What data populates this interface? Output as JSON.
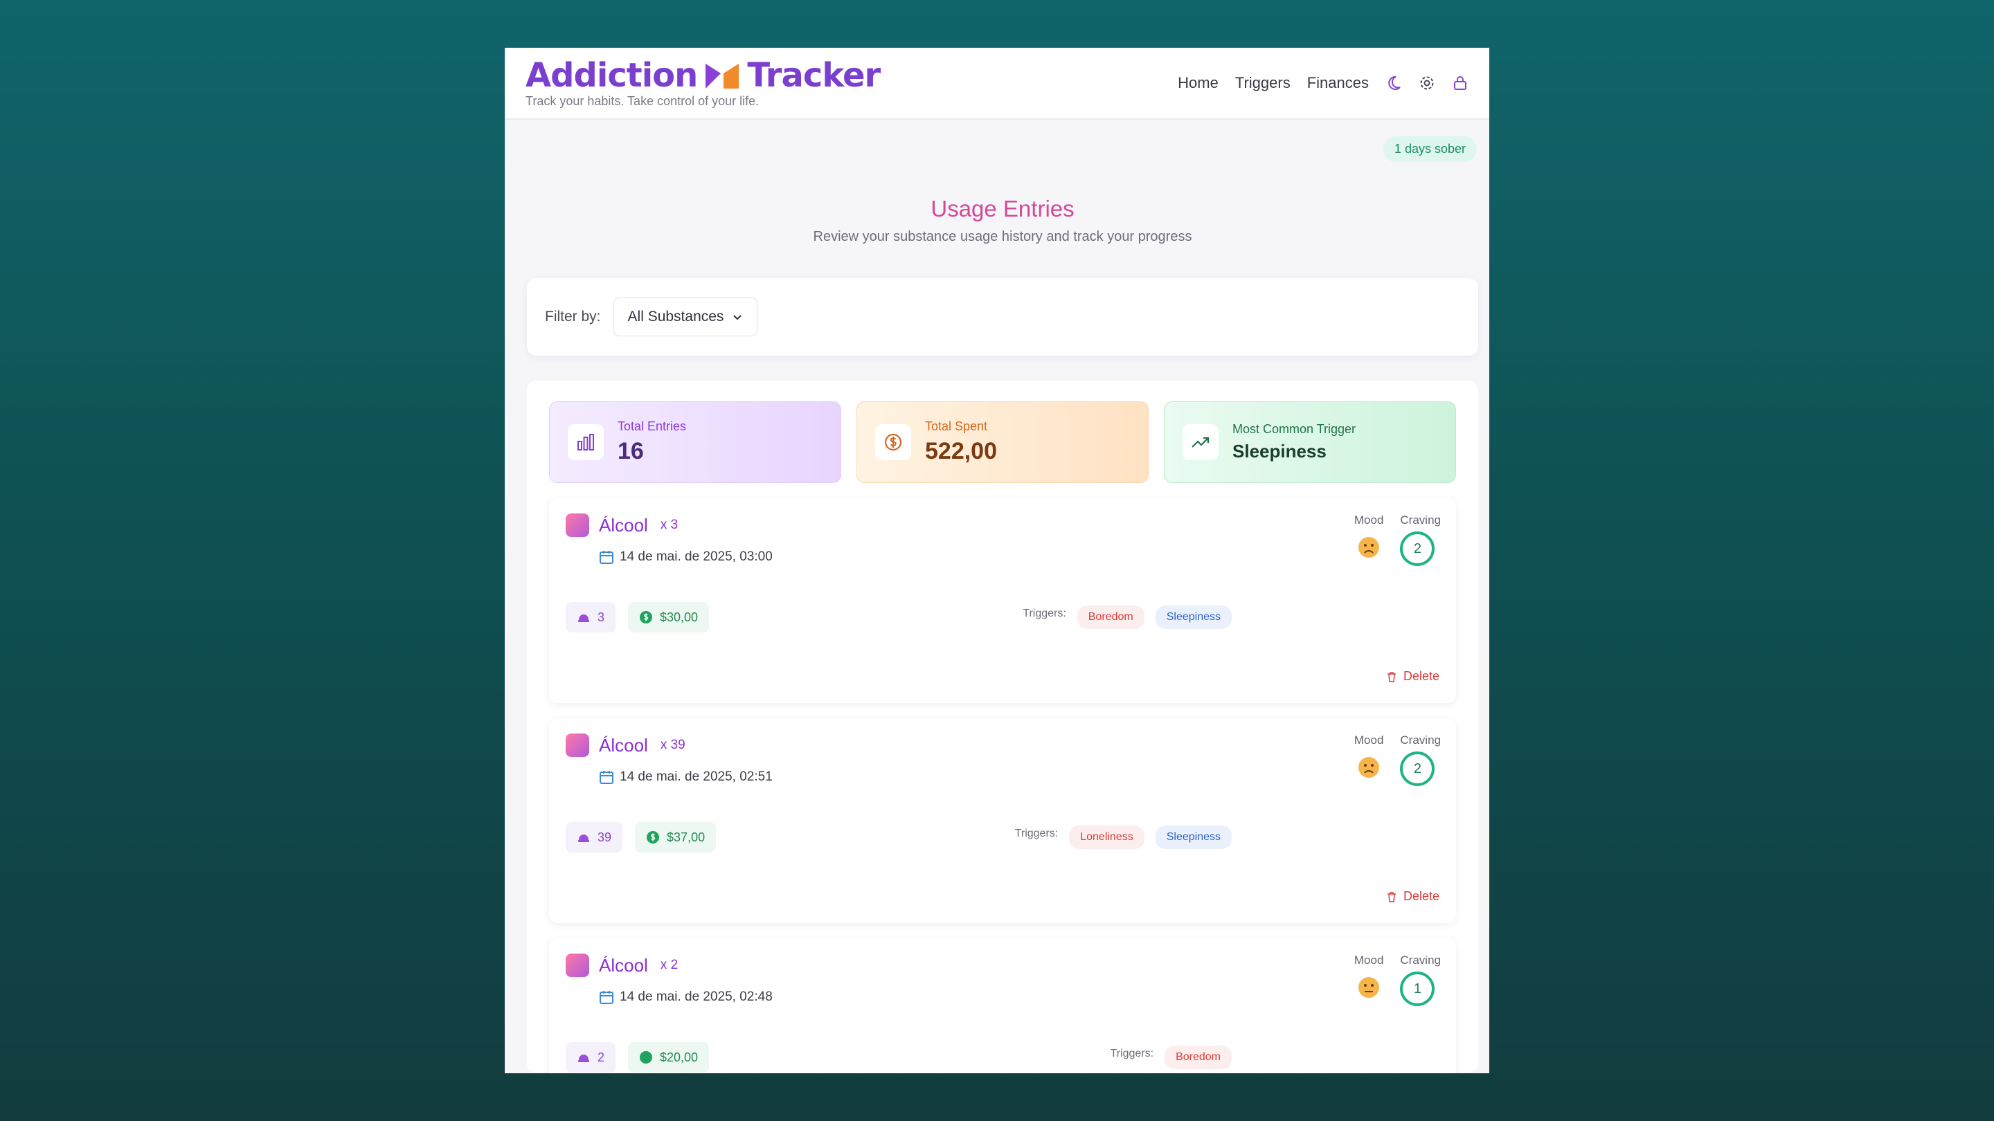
{
  "app": {
    "title_part1": "Addiction",
    "title_part2": "Tracker",
    "tagline": "Track your habits. Take control of your life."
  },
  "nav": {
    "items": [
      "Home",
      "Triggers",
      "Finances"
    ],
    "icons": [
      "moon-icon",
      "gear-icon",
      "lock-icon"
    ]
  },
  "sober_badge": "1 days sober",
  "page": {
    "title": "Usage Entries",
    "subtitle": "Review your substance usage history and track your progress"
  },
  "filter": {
    "label": "Filter by:",
    "selected": "All Substances"
  },
  "stats": {
    "total_entries": {
      "label": "Total Entries",
      "value": "16"
    },
    "total_spent": {
      "label": "Total Spent",
      "value": "522,00"
    },
    "common_trigger": {
      "label": "Most Common Trigger",
      "value": "Sleepiness"
    }
  },
  "labels": {
    "mood": "Mood",
    "craving": "Craving",
    "triggers": "Triggers:",
    "delete": "Delete"
  },
  "entries": [
    {
      "substance": "Álcool",
      "qty_label": "x 3",
      "date": "14 de mai. de 2025, 03:00",
      "craving": "2",
      "quantity": "3",
      "cost": "$30,00",
      "triggers": [
        "Boredom",
        "Sleepiness"
      ]
    },
    {
      "substance": "Álcool",
      "qty_label": "x 39",
      "date": "14 de mai. de 2025, 02:51",
      "craving": "2",
      "quantity": "39",
      "cost": "$37,00",
      "triggers": [
        "Loneliness",
        "Sleepiness"
      ]
    },
    {
      "substance": "Álcool",
      "qty_label": "x 2",
      "date": "14 de mai. de 2025, 02:48",
      "craving": "1",
      "quantity": "2",
      "cost": "$20,00",
      "triggers": [
        "Boredom"
      ]
    }
  ],
  "colors": {
    "brand": "#7b3fd0",
    "accent_pink": "#d6479a",
    "danger": "#d83b3b",
    "success": "#1fb487"
  }
}
